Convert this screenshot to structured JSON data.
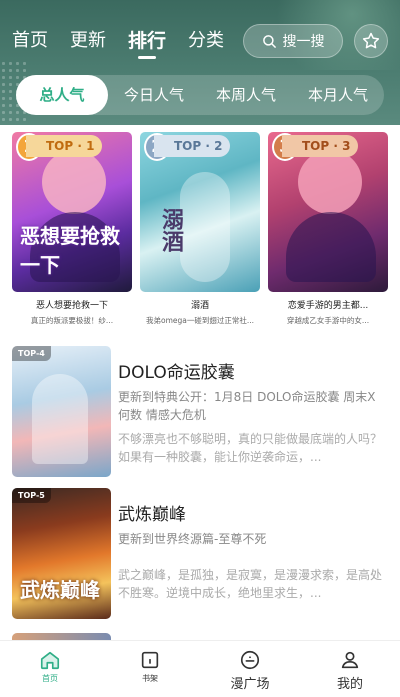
{
  "header": {
    "tabs": [
      {
        "label": "首页"
      },
      {
        "label": "更新"
      },
      {
        "label": "排行",
        "active": true
      },
      {
        "label": "分类"
      }
    ],
    "search_label": "搜一搜",
    "search_icon": "search-icon",
    "favorite_icon": "star-icon",
    "sub_tabs": [
      {
        "label": "总人气",
        "active": true
      },
      {
        "label": "今日人气"
      },
      {
        "label": "本周人气"
      },
      {
        "label": "本月人气"
      }
    ]
  },
  "top3": [
    {
      "rank": "1",
      "tag": "TOP · 1",
      "cover_text": "恶想要抢救一下",
      "title": "恶人想要抢救一下",
      "desc": "真正的叛派要极拔！纱..."
    },
    {
      "rank": "2",
      "tag": "TOP · 2",
      "cover_text": "溺酒",
      "title": "溺酒",
      "desc": "我弟omega一碰到翅过正常社..."
    },
    {
      "rank": "3",
      "tag": "TOP · 3",
      "cover_text": "",
      "title": "恋爱手游的男主都...",
      "desc": "穿越成乙女手游中的女..."
    }
  ],
  "list": [
    {
      "tag": "TOP-4",
      "title": "DOLO命运胶囊",
      "update": "更新到特典公开：1月8日 DOLO命运胶囊 周末X何数 情感大危机",
      "desc": "不够漂亮也不够聪明，真的只能做最底端的人吗？如果有一种胶囊，能让你逆袭命运，..."
    },
    {
      "tag": "TOP-5",
      "title": "武炼巅峰",
      "cover_text": "武炼巅峰",
      "update": "更新到世界终源篇-至尊不死",
      "desc": "武之巅峰，是孤独，是寂寞，是漫漫求索，是高处不胜寒。逆境中成长，绝地里求生，..."
    }
  ],
  "bottom_nav": [
    {
      "label": "首页",
      "icon": "home-icon",
      "active": true
    },
    {
      "label": "书架",
      "icon": "bookshelf-icon"
    },
    {
      "label": "漫广场",
      "icon": "square-icon"
    },
    {
      "label": "我的",
      "icon": "profile-icon"
    }
  ],
  "colors": {
    "accent": "#2fae87",
    "header_bg": "#3b6a5f"
  }
}
